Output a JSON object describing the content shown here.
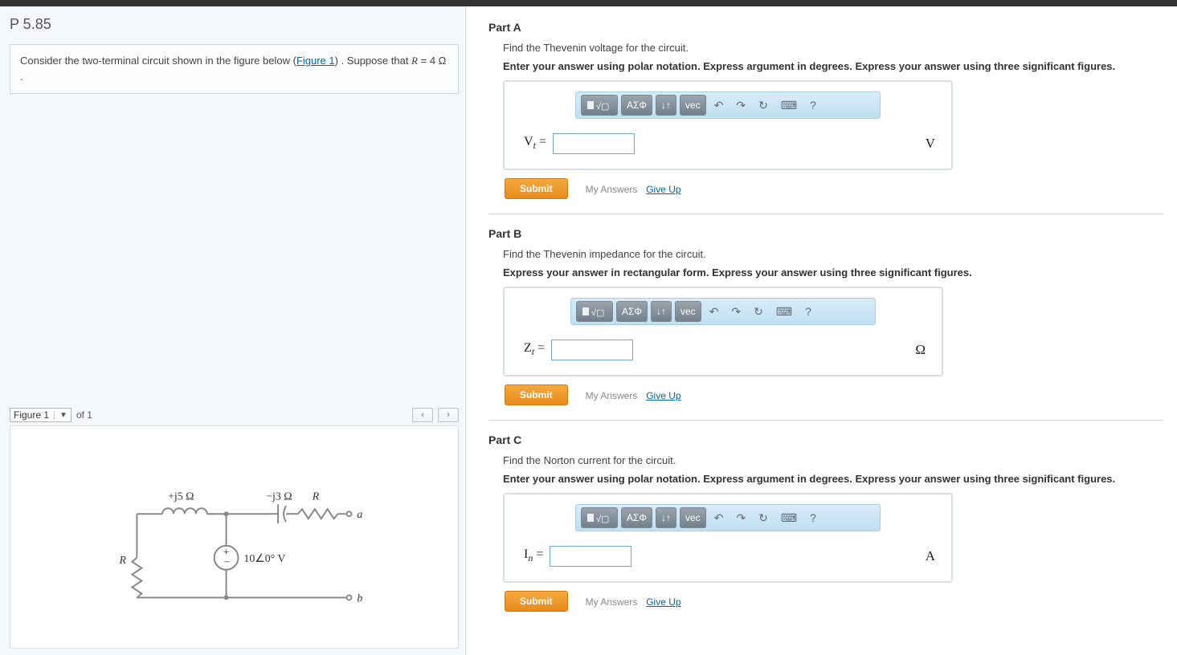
{
  "problem": {
    "code": "P 5.85",
    "intro_pre": "Consider the two-terminal circuit shown in the figure below (",
    "figure_link": "Figure 1",
    "intro_mid": ") . Suppose that ",
    "var": "R",
    "intro_post1": " = ",
    "value": "4 Ω",
    "intro_post2": " ."
  },
  "figure": {
    "select_label": "Figure 1",
    "of_text": "of 1",
    "labels": {
      "L_ind": "+j5 Ω",
      "C_cap": "−j3 Ω",
      "R_right": "R",
      "R_left": "R",
      "source": "10∠0° V",
      "node_a": "a",
      "node_b": "b"
    }
  },
  "parts": [
    {
      "title": "Part A",
      "instr": "Find the Thevenin voltage for the circuit.",
      "hint": "Enter your answer using polar notation. Express argument in degrees. Express your answer using three significant figures.",
      "sym_html": "V<sub>t</sub>",
      "eq": " = ",
      "unit": "V"
    },
    {
      "title": "Part B",
      "instr": "Find the Thevenin impedance for the circuit.",
      "hint": "Express your answer in rectangular form. Express your answer using three significant figures.",
      "sym_html": "Z<sub>t</sub>",
      "eq": " = ",
      "unit": "Ω"
    },
    {
      "title": "Part C",
      "instr": "Find the Norton current for the circuit.",
      "hint": "Enter your answer using polar notation. Express argument in degrees. Express your answer using three significant figures.",
      "sym_html": "I<sub>n</sub>",
      "eq": " = ",
      "unit": "A"
    }
  ],
  "toolbar": {
    "greek": "ΑΣΦ",
    "subsup": "↓↑",
    "vec": "vec",
    "undo": "↶",
    "redo": "↷",
    "reset": "↻",
    "keyboard": "⌨",
    "help": "?"
  },
  "actions": {
    "submit": "Submit",
    "my_answers": "My Answers",
    "give_up": "Give Up"
  }
}
